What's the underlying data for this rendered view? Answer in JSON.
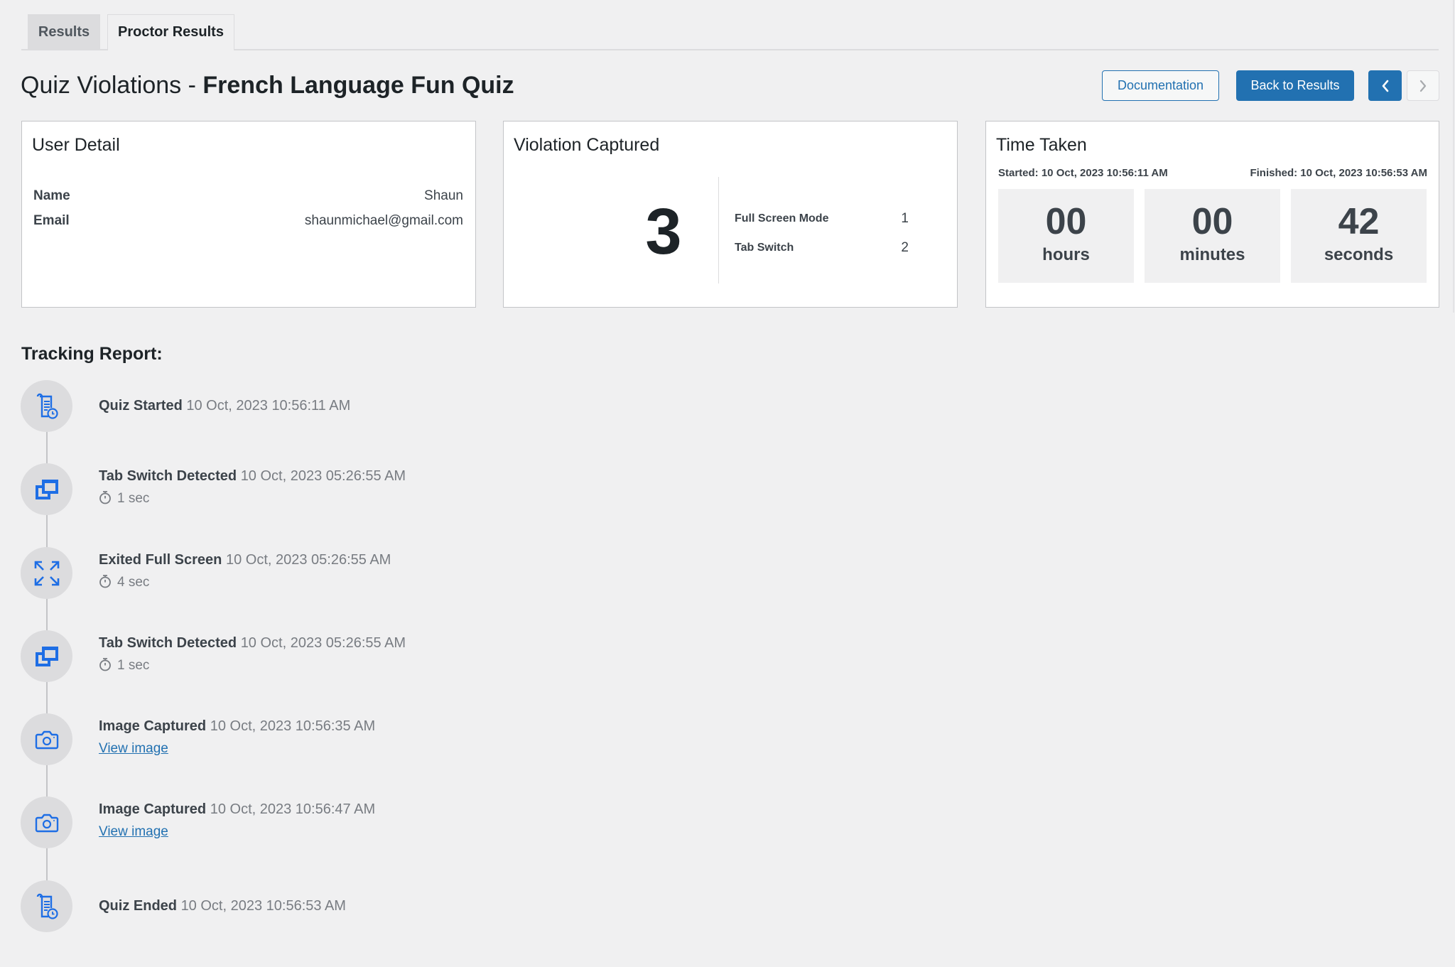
{
  "tabs": [
    {
      "label": "Results",
      "active": false
    },
    {
      "label": "Proctor Results",
      "active": true
    }
  ],
  "header": {
    "title_prefix": "Quiz Violations - ",
    "quiz_name": "French Language Fun Quiz",
    "documentation_label": "Documentation",
    "back_label": "Back to Results",
    "prev_icon": "chevron-left-icon",
    "next_icon": "chevron-right-icon"
  },
  "user_detail": {
    "title": "User Detail",
    "rows": [
      {
        "label": "Name",
        "value": "Shaun"
      },
      {
        "label": "Email",
        "value": "shaunmichael@gmail.com"
      }
    ]
  },
  "violations": {
    "title": "Violation Captured",
    "total": "3",
    "breakdown": [
      {
        "label": "Full Screen Mode",
        "count": "1"
      },
      {
        "label": "Tab Switch",
        "count": "2"
      }
    ]
  },
  "time_taken": {
    "title": "Time Taken",
    "started": "Started: 10 Oct, 2023 10:56:11 AM",
    "finished": "Finished: 10 Oct, 2023 10:56:53 AM",
    "units": [
      {
        "value": "00",
        "label": "hours"
      },
      {
        "value": "00",
        "label": "minutes"
      },
      {
        "value": "42",
        "label": "seconds"
      }
    ]
  },
  "tracking": {
    "title": "Tracking Report:",
    "items": [
      {
        "icon": "quiz-document-clock-icon",
        "event": "Quiz Started",
        "time": "10 Oct, 2023 10:56:11 AM"
      },
      {
        "icon": "tab-switch-icon",
        "event": "Tab Switch Detected",
        "time": "10 Oct, 2023 05:26:55 AM",
        "duration": "1 sec"
      },
      {
        "icon": "exit-fullscreen-icon",
        "event": "Exited Full Screen",
        "time": "10 Oct, 2023 05:26:55 AM",
        "duration": "4 sec"
      },
      {
        "icon": "tab-switch-icon",
        "event": "Tab Switch Detected",
        "time": "10 Oct, 2023 05:26:55 AM",
        "duration": "1 sec"
      },
      {
        "icon": "camera-icon",
        "event": "Image Captured",
        "time": "10 Oct, 2023 10:56:35 AM",
        "link": "View image"
      },
      {
        "icon": "camera-icon",
        "event": "Image Captured",
        "time": "10 Oct, 2023 10:56:47 AM",
        "link": "View image"
      },
      {
        "icon": "quiz-document-clock-icon",
        "event": "Quiz Ended",
        "time": "10 Oct, 2023 10:56:53 AM"
      }
    ]
  },
  "colors": {
    "accent": "#2271b1",
    "icon_blue": "#1e6ee5",
    "background": "#f0f0f1"
  }
}
